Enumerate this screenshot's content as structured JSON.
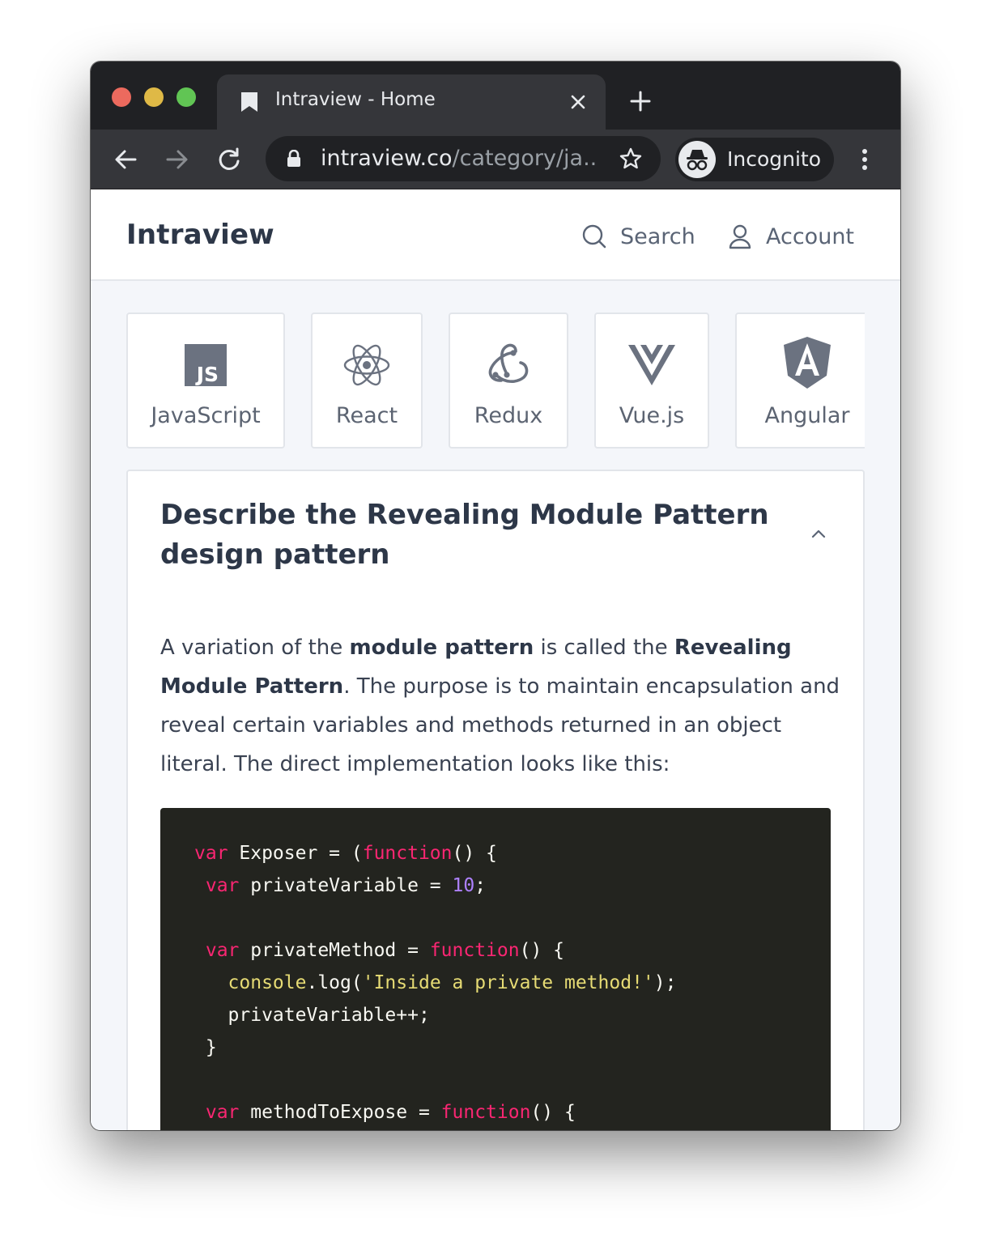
{
  "browser": {
    "tab_title": "Intraview - Home",
    "url_host": "intraview.co",
    "url_path": "/category/ja...",
    "incognito_label": "Incognito"
  },
  "site": {
    "logo": "Intraview",
    "search_label": "Search",
    "account_label": "Account"
  },
  "categories": [
    {
      "label": "JavaScript",
      "icon": "javascript-icon"
    },
    {
      "label": "React",
      "icon": "react-icon"
    },
    {
      "label": "Redux",
      "icon": "redux-icon"
    },
    {
      "label": "Vue.js",
      "icon": "vuejs-icon"
    },
    {
      "label": "Angular",
      "icon": "angular-icon"
    }
  ],
  "question": {
    "title": "Describe the Revealing Module Pattern design pattern",
    "expanded": true,
    "answer": {
      "p1": "A variation of the ",
      "b1": "module pattern",
      "p2": " is called the ",
      "b2": "Revealing Module Pattern",
      "p3": ". The purpose is to maintain encapsulation and reveal certain variables and methods returned in an object literal. The direct implementation looks like this:"
    },
    "code": [
      [
        [
          "kw",
          "var"
        ],
        [
          "pl",
          " Exposer = ("
        ],
        [
          "kw",
          "function"
        ],
        [
          "pl",
          "() {"
        ]
      ],
      [
        [
          "pl",
          " "
        ],
        [
          "kw",
          "var"
        ],
        [
          "pl",
          " privateVariable = "
        ],
        [
          "num",
          "10"
        ],
        [
          "pl",
          ";"
        ]
      ],
      [],
      [
        [
          "pl",
          " "
        ],
        [
          "kw",
          "var"
        ],
        [
          "pl",
          " privateMethod = "
        ],
        [
          "kw",
          "function"
        ],
        [
          "pl",
          "() {"
        ]
      ],
      [
        [
          "pl",
          "   "
        ],
        [
          "obj",
          "console"
        ],
        [
          "pl",
          ".log("
        ],
        [
          "str",
          "'Inside a private method!'"
        ],
        [
          "pl",
          ");"
        ]
      ],
      [
        [
          "pl",
          "   privateVariable++;"
        ]
      ],
      [
        [
          "pl",
          " }"
        ]
      ],
      [],
      [
        [
          "pl",
          " "
        ],
        [
          "kw",
          "var"
        ],
        [
          "pl",
          " methodToExpose = "
        ],
        [
          "kw",
          "function"
        ],
        [
          "pl",
          "() {"
        ]
      ]
    ]
  },
  "colors": {
    "code_bg": "#23241f",
    "keyword": "#f92672",
    "number": "#ae81ff",
    "string": "#e6db74"
  }
}
